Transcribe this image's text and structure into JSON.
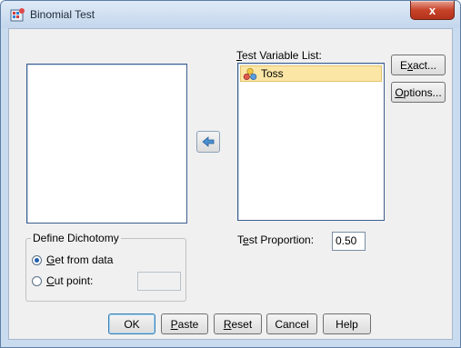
{
  "window": {
    "title": "Binomial Test",
    "close_label": "x"
  },
  "test_variable_list": {
    "label_prefix": "",
    "label_accel": "T",
    "label_rest": "est Variable List:",
    "items": [
      {
        "name": "Toss",
        "icon": "scale-variable-icon"
      }
    ]
  },
  "move_button": {
    "icon": "arrow-left-icon"
  },
  "side_buttons": {
    "exact": {
      "pre": "E",
      "accel": "x",
      "post": "act..."
    },
    "options": {
      "pre": "",
      "accel": "O",
      "post": "ptions..."
    }
  },
  "define_dichotomy": {
    "title": "Define Dichotomy",
    "get_from_data": {
      "pre": "",
      "accel": "G",
      "post": "et from data",
      "selected": true
    },
    "cut_point": {
      "pre": "",
      "accel": "C",
      "post": "ut point:",
      "selected": false,
      "value": ""
    }
  },
  "test_proportion": {
    "pre": "T",
    "accel": "e",
    "post": "st Proportion:",
    "value": "0.50"
  },
  "buttons": {
    "ok": {
      "pre": "OK",
      "accel": "",
      "post": ""
    },
    "paste": {
      "pre": "",
      "accel": "P",
      "post": "aste"
    },
    "reset": {
      "pre": "",
      "accel": "R",
      "post": "eset"
    },
    "cancel": {
      "pre": "Cancel",
      "accel": "",
      "post": ""
    },
    "help": {
      "pre": "Help",
      "accel": "",
      "post": ""
    }
  },
  "colors": {
    "title_bg": "#c9dbee",
    "selection": "#fbe6a6",
    "close": "#c7442a"
  }
}
